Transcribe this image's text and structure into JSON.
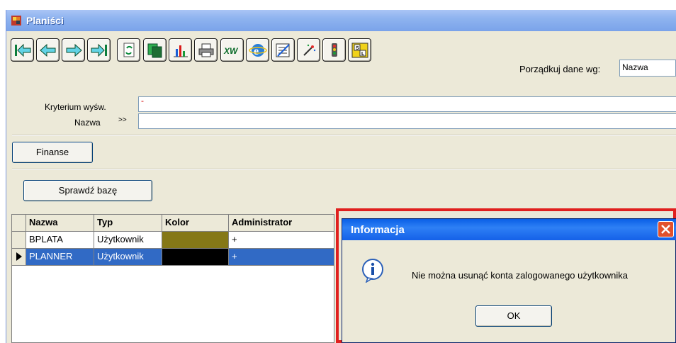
{
  "window": {
    "title": "Planiści"
  },
  "toolbar": {
    "buttons": [
      {
        "name": "first-record-icon"
      },
      {
        "name": "previous-record-icon"
      },
      {
        "name": "next-record-icon"
      },
      {
        "name": "last-record-icon"
      },
      {
        "name": "refresh-icon"
      },
      {
        "name": "copy-icon"
      },
      {
        "name": "chart-icon"
      },
      {
        "name": "print-icon"
      },
      {
        "name": "export-excel-icon"
      },
      {
        "name": "internet-explorer-icon"
      },
      {
        "name": "edit-list-icon"
      },
      {
        "name": "wand-icon"
      },
      {
        "name": "traffic-light-icon"
      },
      {
        "name": "sql-icon"
      }
    ],
    "sort_label": "Porządkuj dane wg:",
    "sort_value": "Nazwa"
  },
  "filters": {
    "criterion_label": "Kryterium wyśw.",
    "criterion_value": "-",
    "name_label": "Nazwa",
    "name_op": ">>",
    "name_value": ""
  },
  "buttons": {
    "finance": "Finanse",
    "check_db": "Sprawdź bazę"
  },
  "grid": {
    "columns": [
      "Nazwa",
      "Typ",
      "Kolor",
      "Administrator"
    ],
    "rows": [
      {
        "nazwa": "BPLATA",
        "typ": "Użytkownik",
        "kolor": "#857817",
        "admin": "+",
        "selected": false
      },
      {
        "nazwa": "PLANNER",
        "typ": "Użytkownik",
        "kolor": "#000000",
        "admin": "+",
        "selected": true
      }
    ]
  },
  "dialog": {
    "title": "Informacja",
    "message": "Nie można usunąć konta zalogowanego użytkownika",
    "ok_label": "OK"
  },
  "colors": {
    "selection": "#316ac5",
    "highlight_frame": "#e0201e"
  }
}
